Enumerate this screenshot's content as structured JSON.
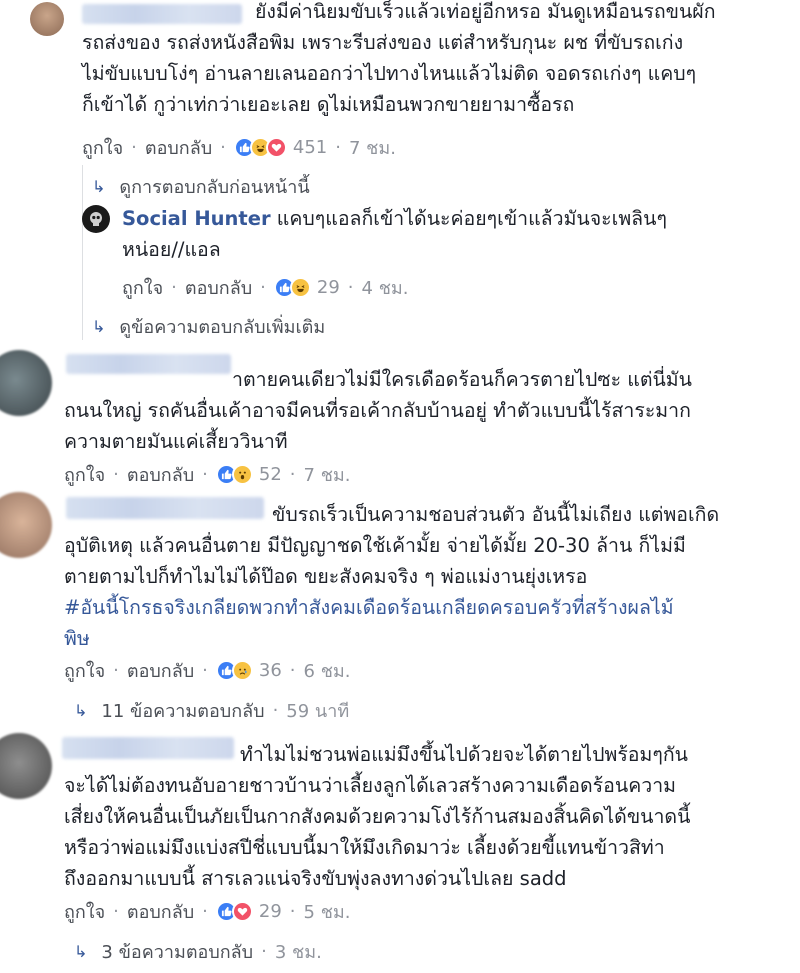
{
  "actions": {
    "like": "ถูกใจ",
    "reply": "ตอบกลับ"
  },
  "comments": [
    {
      "author": "",
      "lines": [
        "ยังมีค่านิยมขับเร็วแล้วเท่อยู่อีกหรอ มันดูเหมือนรถขนผัก",
        "รถส่งของ รถส่งหนังสือพิม เพราะรีบส่งของ แต่สำหรับกุนะ ผช ที่ขับรถเก่ง",
        "ไม่ขับแบบโง่ๆ อ่านลายเลนออกว่าไปทางไหนแล้วไม่ติด จอดรถเก่งๆ แคบๆ",
        "ก็เข้าได้ กูว่าเท่กว่าเยอะเลย ดูไม่เหมือนพวกขายยามาซื้อรถ"
      ],
      "reaction_count": "451",
      "time": "7 ชม.",
      "reactions": [
        "like",
        "haha",
        "love"
      ],
      "prev_replies": "ดูการตอบกลับก่อนหน้านี้",
      "reply": {
        "author": "Social Hunter",
        "lines": [
          "แคบๆแอลก็เข้าได้นะค่อยๆเข้าแล้วมันจะเพลินๆ",
          "หน่อย//แอล"
        ],
        "reaction_count": "29",
        "time": "4 ชม.",
        "reactions": [
          "like",
          "haha"
        ]
      },
      "more_replies": "ดูข้อความตอบกลับเพิ่มเติม"
    },
    {
      "lines": [
        "าตายคนเดียวไม่มีใครเดือดร้อนก็ควรตายไปซะ แต่นี่มัน",
        "ถนนใหญ่ รถคันอื่นเค้าอาจมีคนที่รอเค้ากลับบ้านอยู่ ทำตัวแบบนี้ไร้สาระมาก",
        "ความตายมันแค่เสี้ยววินาที"
      ],
      "reaction_count": "52",
      "time": "7 ชม.",
      "reactions": [
        "like",
        "wow"
      ]
    },
    {
      "lines": [
        "ขับรถเร็วเป็นความชอบส่วนตัว อันนี้ไม่เถียง แต่พอเกิด",
        "อุบัติเหตุ แล้วคนอื่นตาย มีปัญญาชดใช้เค้ามั้ย จ่ายได้มั้ย 20-30 ล้าน ก็ไม่มี",
        "ตายตามไปก็ทำไมไม่ได้ป๊อด ขยะสังคมจริง ๆ พ่อแม่งานยุ่งเหรอ"
      ],
      "hashtag_lines": [
        "#อันนี้โกรธจริงเกลียดพวกทำสังคมเดือดร้อนเกลียดครอบครัวที่สร้างผลไม้",
        "พิษ"
      ],
      "reaction_count": "36",
      "time": "6 ชม.",
      "reactions": [
        "like",
        "sad"
      ],
      "replies_summary": "11 ข้อความตอบกลับ",
      "replies_time": "59 นาที"
    },
    {
      "lines": [
        "ทำไมไม่ชวนพ่อแม่มึงขึ้นไปด้วยจะได้ตายไปพร้อมๆกัน",
        "จะได้ไม่ต้องทนอับอายชาวบ้านว่าเลี้ยงลูกได้เลวสร้างความเดือดร้อนความ",
        "เสี่ยงให้คนอื่นเป็นภัยเป็นกากสังคมด้วยความโง่ไร้ก้านสมองสิ้นคิดได้ขนาดนี้",
        "หรือว่าพ่อแม่มึงแบ่งสปีชี่แบบนี้มาให้มึงเกิดมาว่ะ เลี้ยงด้วยขี้แทนข้าวสิท่า",
        "ถึงออกมาแบบนี้ สารเลวแน่จริงขับพุ่งลงทางด่วนไปเลย sadd"
      ],
      "reaction_count": "29",
      "time": "5 ชม.",
      "reactions": [
        "like",
        "love"
      ],
      "replies_summary": "3 ข้อความตอบกลับ",
      "replies_time": "3 ชม."
    }
  ]
}
